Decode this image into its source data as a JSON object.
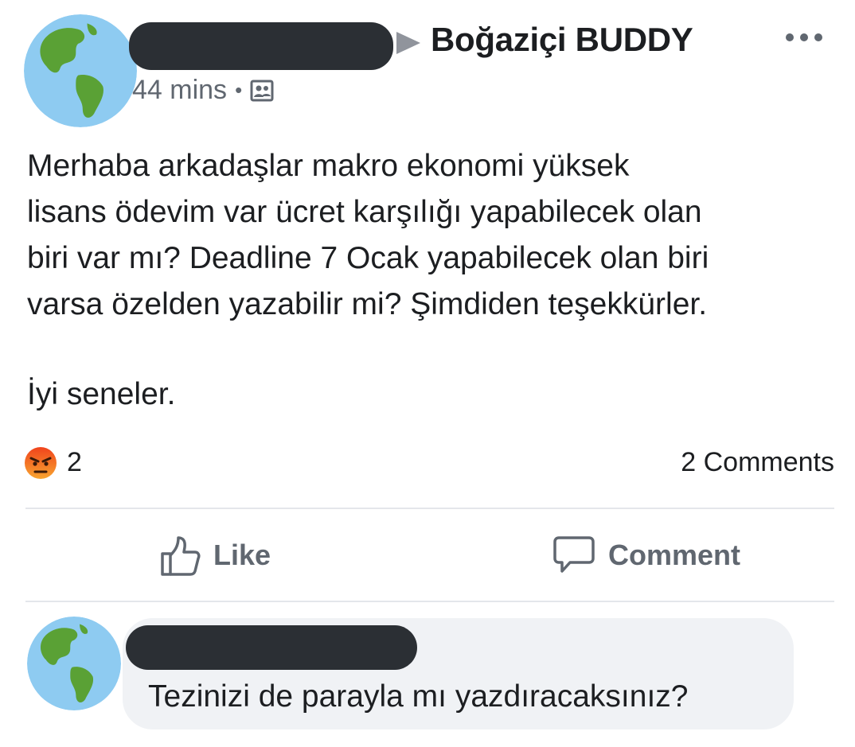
{
  "post": {
    "group_name": "Boğaziçi BUDDY",
    "timestamp": "44 mins",
    "separator": "•",
    "body": "Merhaba arkadaşlar makro ekonomi yüksek\nlisans ödevim var ücret karşılığı yapabilecek olan\nbiri var mı? Deadline 7 Ocak yapabilecek olan biri\nvarsa özelden yazabilir mi? Şimdiden teşekkürler.",
    "closing": "İyi seneler.",
    "reaction_count": "2",
    "comments_count": "2 Comments"
  },
  "actions": {
    "like_label": "Like",
    "comment_label": "Comment"
  },
  "comment": {
    "text": "Tezinizi de parayla mı yazdıracaksınız?"
  },
  "icons": {
    "avatar": "globe-americas-icon",
    "group_arrow": "triangle-right-icon",
    "more": "ellipsis-icon",
    "privacy": "group-members-icon",
    "reaction": "angry-emoji-icon",
    "like": "thumbs-up-icon",
    "comment": "speech-bubble-icon"
  },
  "colors": {
    "text_primary": "#1c1e21",
    "text_secondary": "#606770",
    "divider": "#e4e6eb",
    "comment_bg": "#f0f2f5",
    "redaction": "#2b2f34"
  }
}
